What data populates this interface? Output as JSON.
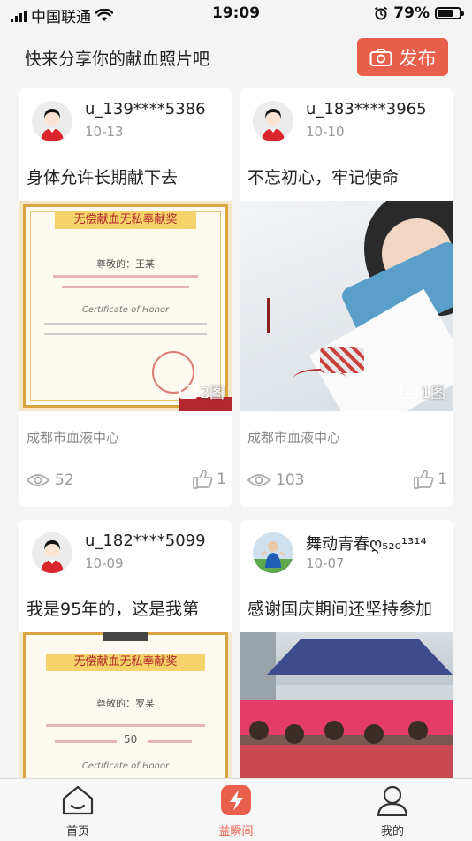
{
  "status_bar": {
    "carrier": "中国联通",
    "time": "19:09",
    "battery": "79%",
    "battery_level": 0.79
  },
  "header": {
    "title": "快来分享你的献血照片吧",
    "publish_label": "发布",
    "publish_icon": "camera-icon"
  },
  "posts": [
    {
      "user": "u_139****5386",
      "date": "10-13",
      "caption": "身体允许长期献下去",
      "image_count": "2图",
      "location": "成都市血液中心",
      "views": "52",
      "likes": "1",
      "cert_title": "无偿献血无私奉献奖",
      "cert_recipient": "尊敬的：王某",
      "cert_en": "Certificate of Honor"
    },
    {
      "user": "u_183****3965",
      "date": "10-10",
      "caption": "不忘初心，牢记使命",
      "image_count": "1图",
      "location": "成都市血液中心",
      "views": "103",
      "likes": "1"
    },
    {
      "user": "u_182****5099",
      "date": "10-09",
      "caption": "我是95年的，这是我第",
      "cert_title": "无偿献血无私奉献奖",
      "cert_recipient": "尊敬的：罗某",
      "cert_number": "50",
      "cert_en": "Certificate of Honor"
    },
    {
      "user": "舞动青春ღ₅₂₀¹³¹⁴",
      "date": "10-07",
      "caption": "感谢国庆期间还坚持参加"
    }
  ],
  "tabbar": {
    "home": "首页",
    "moment": "益瞬间",
    "me": "我的"
  },
  "colors": {
    "accent": "#e8604c",
    "background": "#f4f4f4",
    "muted_text": "#999999"
  }
}
